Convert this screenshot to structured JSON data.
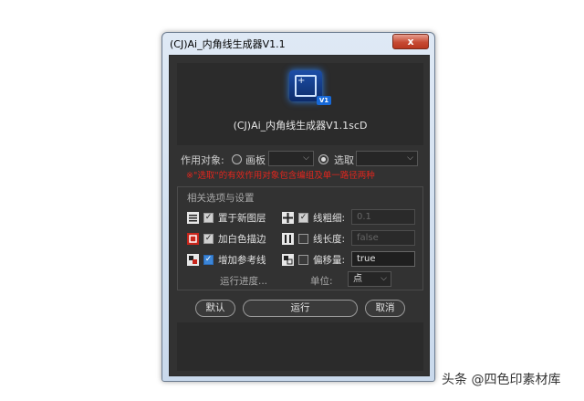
{
  "window": {
    "title": "(CJ)Ai_内角线生成器V1.1",
    "close_label": "x"
  },
  "header": {
    "logo_badge": "V1",
    "subtitle": "(CJ)Ai_内角线生成器V1.1scD"
  },
  "target": {
    "label": "作用对象:",
    "option_artboard": "画板",
    "artboard_value": "",
    "option_selection": "选取",
    "selection_value": "",
    "selected": "选取",
    "warning": "※\"选取\"的有效作用对象包含编组及单一路径两种"
  },
  "options": {
    "group_title": "相关选项与设置",
    "new_layer": {
      "label": "置于新图层",
      "checked": true
    },
    "white_stroke": {
      "label": "加白色描边",
      "checked": true
    },
    "guides": {
      "label": "增加参考线",
      "checked": true
    },
    "line_weight": {
      "label": "线粗细:",
      "checked": true,
      "value": "0.1"
    },
    "line_length": {
      "label": "线长度:",
      "checked": false,
      "value": "false"
    },
    "offset": {
      "label": "偏移量:",
      "checked": false,
      "value": "true"
    }
  },
  "progress": {
    "label": "运行进度..."
  },
  "unit": {
    "label": "单位:",
    "value": "点"
  },
  "buttons": {
    "default": "默认",
    "run": "运行",
    "cancel": "取消"
  },
  "watermark": "头条 @四色印素材库"
}
